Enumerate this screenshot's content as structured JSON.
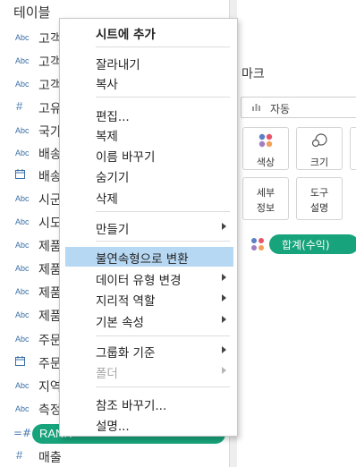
{
  "left_pane": {
    "title": "테이블",
    "fields": [
      {
        "type": "Abc",
        "name": "고객"
      },
      {
        "type": "Abc",
        "name": "고객"
      },
      {
        "type": "Abc",
        "name": "고객"
      },
      {
        "type": "#",
        "name": "고유"
      },
      {
        "type": "Abc",
        "name": "국가"
      },
      {
        "type": "Abc",
        "name": "배송"
      },
      {
        "type": "calendar",
        "name": "배송"
      },
      {
        "type": "Abc",
        "name": "시군"
      },
      {
        "type": "Abc",
        "name": "시도"
      },
      {
        "type": "Abc",
        "name": "제품"
      },
      {
        "type": "Abc",
        "name": "제품"
      },
      {
        "type": "Abc",
        "name": "제품"
      },
      {
        "type": "Abc",
        "name": "제품"
      },
      {
        "type": "Abc",
        "name": "주문"
      },
      {
        "type": "calendar",
        "name": "주문"
      },
      {
        "type": "Abc",
        "name": "지역"
      },
      {
        "type": "Abc",
        "name": "측정"
      }
    ],
    "rank_pill": {
      "type": "=#",
      "label": "RANK"
    },
    "last_field": {
      "type": "#",
      "name": "매출"
    }
  },
  "marks": {
    "title": "마크",
    "mark_type": "자동",
    "buttons": [
      {
        "label": "색상",
        "icon": "color-dots-icon"
      },
      {
        "label": "크기",
        "icon": "size-circles-icon"
      },
      {
        "label_line1": "세부",
        "label_line2": "정보",
        "icon": "none"
      },
      {
        "label_line1": "도구",
        "label_line2": "설명",
        "icon": "none"
      }
    ],
    "pill": {
      "label": "합계(수익)",
      "icon": "color-dots-icon"
    }
  },
  "context_menu": {
    "items": [
      {
        "label": "시트에 추가",
        "style": "bold"
      },
      {
        "label": "잘라내기"
      },
      {
        "label": "복사"
      },
      {
        "label": "편집..."
      },
      {
        "label": "복제"
      },
      {
        "label": "이름 바꾸기"
      },
      {
        "label": "숨기기"
      },
      {
        "label": "삭제"
      },
      {
        "label": "만들기",
        "submenu": true
      },
      {
        "label": "불연속형으로 변환",
        "highlighted": true
      },
      {
        "label": "데이터 유형 변경",
        "submenu": true
      },
      {
        "label": "지리적 역할",
        "submenu": true
      },
      {
        "label": "기본 속성",
        "submenu": true
      },
      {
        "label": "그룹화 기준",
        "submenu": true
      },
      {
        "label": "폴더",
        "submenu": true,
        "disabled": true
      },
      {
        "label": "참조 바꾸기..."
      },
      {
        "label": "설명..."
      }
    ]
  },
  "colors": {
    "accent_green": "#17a37b",
    "highlight_blue": "#b7d8f3",
    "type_icon_blue": "#3a6ea5"
  }
}
